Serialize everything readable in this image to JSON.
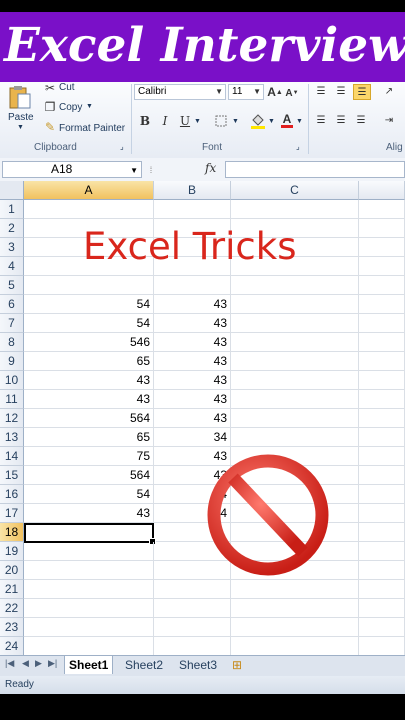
{
  "banner": {
    "title": "Excel Interview"
  },
  "ribbon": {
    "clipboard": {
      "paste": "Paste",
      "cut": "Cut",
      "copy": "Copy",
      "format_painter": "Format Painter",
      "label": "Clipboard"
    },
    "font": {
      "name": "Calibri",
      "size": "11",
      "label": "Font",
      "bold": "B",
      "italic": "I",
      "underline": "U"
    },
    "alignment": {
      "label": "Alig"
    }
  },
  "formula_bar": {
    "name_box": "A18",
    "fx": "fx"
  },
  "sheet": {
    "columns": [
      "A",
      "B",
      "C"
    ],
    "selected_column": "A",
    "selected_row": 18,
    "rows": [
      {
        "n": "1",
        "a": "",
        "b": ""
      },
      {
        "n": "2",
        "a": "",
        "b": ""
      },
      {
        "n": "3",
        "a": "",
        "b": ""
      },
      {
        "n": "4",
        "a": "",
        "b": ""
      },
      {
        "n": "5",
        "a": "",
        "b": ""
      },
      {
        "n": "6",
        "a": "54",
        "b": "43"
      },
      {
        "n": "7",
        "a": "54",
        "b": "43"
      },
      {
        "n": "8",
        "a": "546",
        "b": "43"
      },
      {
        "n": "9",
        "a": "65",
        "b": "43"
      },
      {
        "n": "10",
        "a": "43",
        "b": "43"
      },
      {
        "n": "11",
        "a": "43",
        "b": "43"
      },
      {
        "n": "12",
        "a": "564",
        "b": "43"
      },
      {
        "n": "13",
        "a": "65",
        "b": "34"
      },
      {
        "n": "14",
        "a": "75",
        "b": "43"
      },
      {
        "n": "15",
        "a": "564",
        "b": "43"
      },
      {
        "n": "16",
        "a": "54",
        "b": "34"
      },
      {
        "n": "17",
        "a": "43",
        "b": "34"
      },
      {
        "n": "18",
        "a": "",
        "b": ""
      },
      {
        "n": "19",
        "a": "",
        "b": ""
      },
      {
        "n": "20",
        "a": "",
        "b": ""
      },
      {
        "n": "21",
        "a": "",
        "b": ""
      },
      {
        "n": "22",
        "a": "",
        "b": ""
      },
      {
        "n": "23",
        "a": "",
        "b": ""
      },
      {
        "n": "24",
        "a": "",
        "b": ""
      }
    ],
    "overlay_title": "Excel Tricks"
  },
  "tabs": [
    "Sheet1",
    "Sheet2",
    "Sheet3"
  ],
  "status": {
    "text": "Ready"
  },
  "colors": {
    "banner": "#7a10c8",
    "overlay_title": "#d9261c",
    "no_sign": "#e3322b"
  },
  "icons": [
    "paste-icon",
    "cut-icon",
    "copy-icon",
    "format-painter-icon",
    "no-sign-icon"
  ]
}
